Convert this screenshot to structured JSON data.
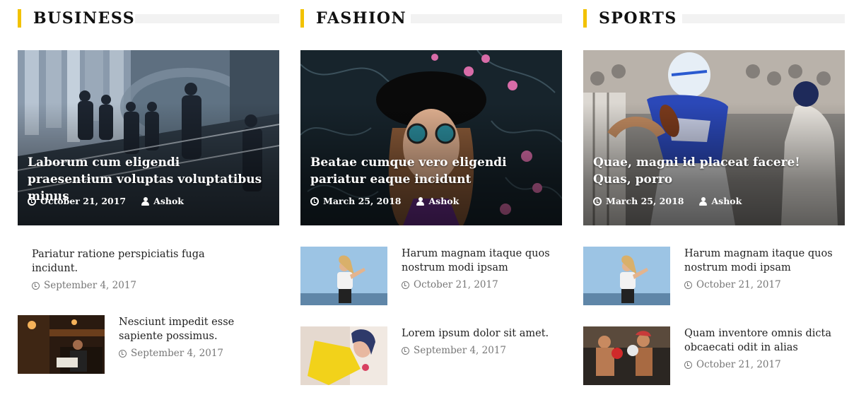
{
  "sections": [
    {
      "title": "BUSINESS",
      "featured": {
        "title": "Laborum cum eligendi praesentium voluptas voluptatibus minus",
        "date": "October 21, 2017",
        "author": "Ashok"
      },
      "items": [
        {
          "title": "Pariatur ratione perspiciatis fuga incidunt.",
          "date": "September 4, 2017"
        },
        {
          "title": "Nesciunt impedit esse sapiente possimus.",
          "date": "September 4, 2017"
        }
      ]
    },
    {
      "title": "FASHION",
      "featured": {
        "title": "Beatae cumque vero eligendi pariatur eaque incidunt",
        "date": "March 25, 2018",
        "author": "Ashok"
      },
      "items": [
        {
          "title": "Harum magnam itaque quos nostrum modi ipsam",
          "date": "October 21, 2017"
        },
        {
          "title": "Lorem ipsum dolor sit amet.",
          "date": "September 4, 2017"
        }
      ]
    },
    {
      "title": "SPORTS",
      "featured": {
        "title": "Quae, magni id placeat facere! Quas, porro",
        "date": "March 25, 2018",
        "author": "Ashok"
      },
      "items": [
        {
          "title": "Harum magnam itaque quos nostrum modi ipsam",
          "date": "October 21, 2017"
        },
        {
          "title": "Quam inventore omnis dicta obcaecati odit in alias",
          "date": "October 21, 2017"
        }
      ]
    }
  ],
  "colors": {
    "accent": "#f2c200",
    "meta_text": "#777777",
    "title_text": "#222222"
  },
  "icons": {
    "date": "clock-icon",
    "author": "user-icon"
  }
}
